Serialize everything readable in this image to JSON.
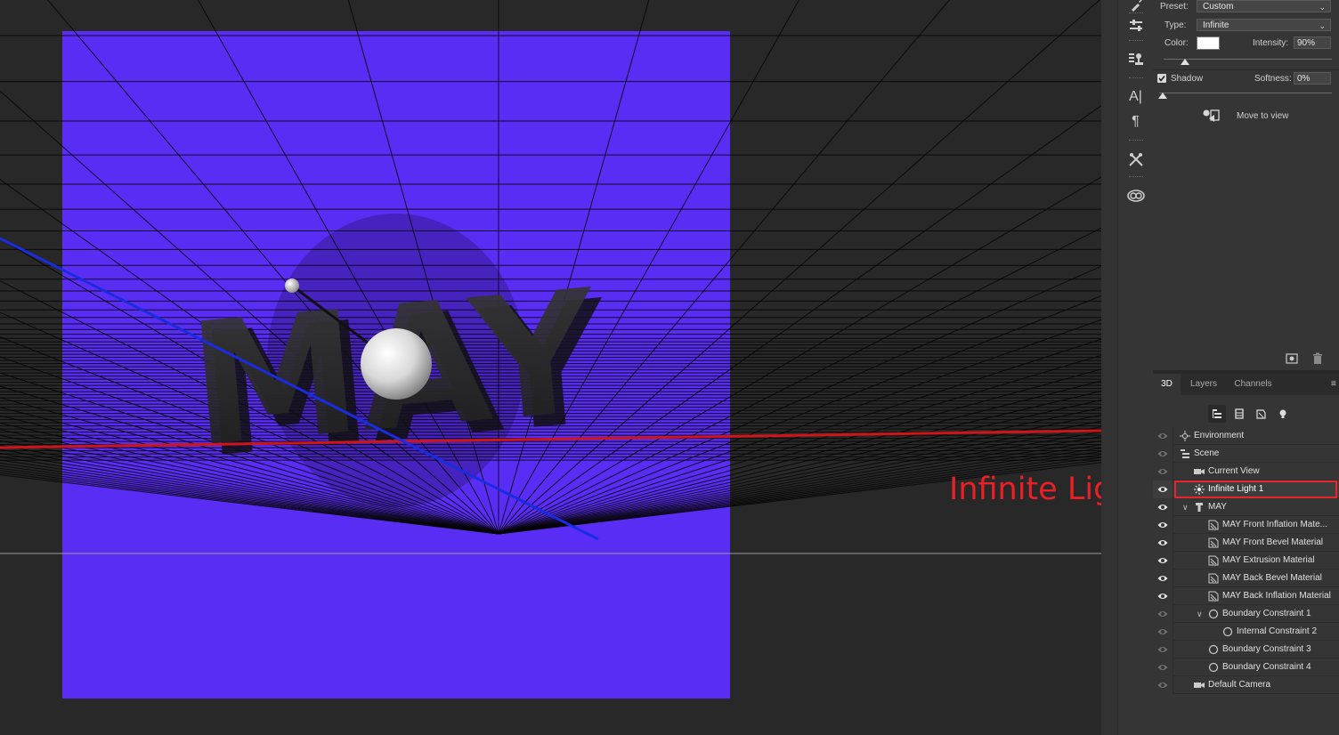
{
  "annotation": {
    "text": "Infinite Light"
  },
  "scene": {
    "text3d": "MAY"
  },
  "properties": {
    "preset_label": "Preset:",
    "preset_value": "Custom",
    "type_label": "Type:",
    "type_value": "Infinite",
    "color_label": "Color:",
    "color_value": "#ffffff",
    "intensity_label": "Intensity:",
    "intensity_value": "90%",
    "shadow_label": "Shadow",
    "shadow_checked": true,
    "softness_label": "Softness:",
    "softness_value": "0%",
    "move_label": "Move to view"
  },
  "panel": {
    "tabs": [
      {
        "label": "3D",
        "active": true
      },
      {
        "label": "Layers",
        "active": false
      },
      {
        "label": "Channels",
        "active": false
      }
    ]
  },
  "layers": [
    {
      "label": "Environment",
      "icon": "environment-icon",
      "eye": "dim",
      "level": 0
    },
    {
      "label": "Scene",
      "icon": "scene-icon",
      "eye": "dim",
      "level": 0
    },
    {
      "label": "Current View",
      "icon": "camera-icon",
      "eye": "dim",
      "level": 1
    },
    {
      "label": "Infinite Light 1",
      "icon": "light-icon",
      "eye": "bright",
      "level": 1,
      "selected": true
    },
    {
      "label": "MAY",
      "icon": "mesh-icon",
      "eye": "bright",
      "level": 1,
      "twirl": "expanded"
    },
    {
      "label": "MAY Front Inflation Mate...",
      "icon": "material-icon",
      "eye": "bright",
      "level": 2
    },
    {
      "label": "MAY Front Bevel Material",
      "icon": "material-icon",
      "eye": "bright",
      "level": 2
    },
    {
      "label": "MAY Extrusion Material",
      "icon": "material-icon",
      "eye": "bright",
      "level": 2
    },
    {
      "label": "MAY Back Bevel Material",
      "icon": "material-icon",
      "eye": "bright",
      "level": 2
    },
    {
      "label": "MAY Back Inflation Material",
      "icon": "material-icon",
      "eye": "bright",
      "level": 2
    },
    {
      "label": "Boundary Constraint 1",
      "icon": "constraint-icon",
      "eye": "dim",
      "level": 2,
      "twirl": "expanded"
    },
    {
      "label": "Internal Constraint 2",
      "icon": "constraint-icon",
      "eye": "dim",
      "level": 3
    },
    {
      "label": "Boundary Constraint 3",
      "icon": "constraint-icon",
      "eye": "dim",
      "level": 2
    },
    {
      "label": "Boundary Constraint 4",
      "icon": "constraint-icon",
      "eye": "dim",
      "level": 2
    },
    {
      "label": "Default Camera",
      "icon": "camera-icon",
      "eye": "dim",
      "level": 1
    }
  ],
  "colors": {
    "canvas": "#5a2df5",
    "accent_red": "#e6262e",
    "panel": "#353535",
    "viewport": "#282828"
  }
}
